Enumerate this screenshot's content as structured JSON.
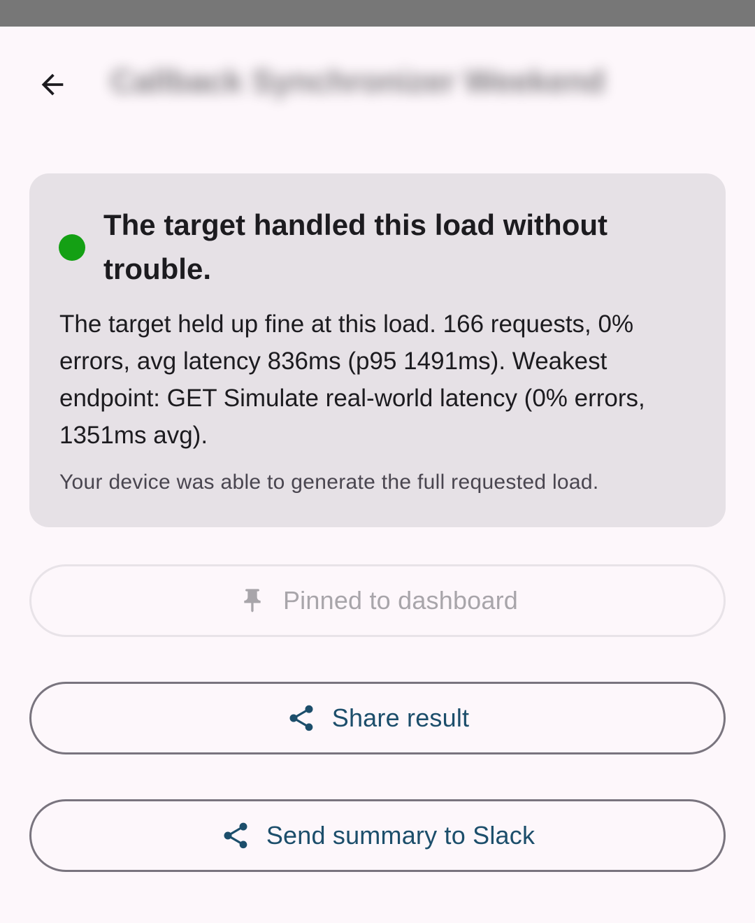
{
  "app_bar": {
    "back_label": "Back",
    "title_obscured": "Callback Synchronizer Weekend"
  },
  "result_card": {
    "status_color": "#14a014",
    "heading": "The target handled this load without trouble.",
    "summary": "The target held up fine at this load. 166 requests, 0% errors, avg latency 836ms (p95 1491ms). Weakest endpoint: GET Simulate real-world latency (0% errors, 1351ms avg).",
    "device_note": "Your device was able to generate the full requested load."
  },
  "actions": {
    "pinned": {
      "label": "Pinned to dashboard",
      "icon": "pin-icon",
      "enabled": false
    },
    "share": {
      "label": "Share result",
      "icon": "share-icon"
    },
    "slack": {
      "label": "Send summary to Slack",
      "icon": "share-icon"
    }
  },
  "colors": {
    "background": "#fdf7fb",
    "card": "#e6e1e6",
    "accent": "#1c4e6b",
    "success": "#14a014"
  }
}
